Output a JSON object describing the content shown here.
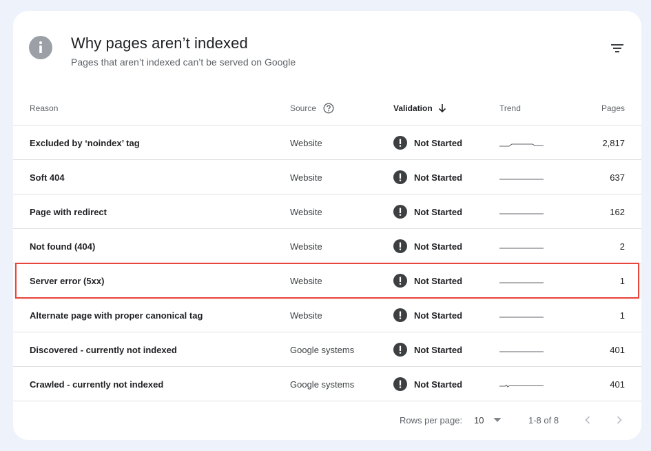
{
  "header": {
    "title": "Why pages aren’t indexed",
    "subtitle": "Pages that aren’t indexed can’t be served on Google",
    "icon": "info-icon",
    "filter_icon": "filter-icon"
  },
  "table": {
    "columns": {
      "reason": "Reason",
      "source": "Source",
      "validation": "Validation",
      "trend": "Trend",
      "pages": "Pages"
    },
    "rows": [
      {
        "reason": "Excluded by ‘noindex’ tag",
        "source": "Website",
        "validation": "Not Started",
        "pages": "2,817",
        "trend": "bump"
      },
      {
        "reason": "Soft 404",
        "source": "Website",
        "validation": "Not Started",
        "pages": "637",
        "trend": "flat"
      },
      {
        "reason": "Page with redirect",
        "source": "Website",
        "validation": "Not Started",
        "pages": "162",
        "trend": "flat"
      },
      {
        "reason": "Not found (404)",
        "source": "Website",
        "validation": "Not Started",
        "pages": "2",
        "trend": "flat"
      },
      {
        "reason": "Server error (5xx)",
        "source": "Website",
        "validation": "Not Started",
        "pages": "1",
        "trend": "flat",
        "highlighted": true
      },
      {
        "reason": "Alternate page with proper canonical tag",
        "source": "Website",
        "validation": "Not Started",
        "pages": "1",
        "trend": "flat"
      },
      {
        "reason": "Discovered - currently not indexed",
        "source": "Google systems",
        "validation": "Not Started",
        "pages": "401",
        "trend": "flat"
      },
      {
        "reason": "Crawled - currently not indexed",
        "source": "Google systems",
        "validation": "Not Started",
        "pages": "401",
        "trend": "dip"
      }
    ]
  },
  "footer": {
    "rows_per_page_label": "Rows per page:",
    "rows_per_page_value": "10",
    "range": "1-8 of 8"
  },
  "colors": {
    "highlight": "#e8453c",
    "status_icon": "#3c4043",
    "background": "#eef2fb"
  }
}
